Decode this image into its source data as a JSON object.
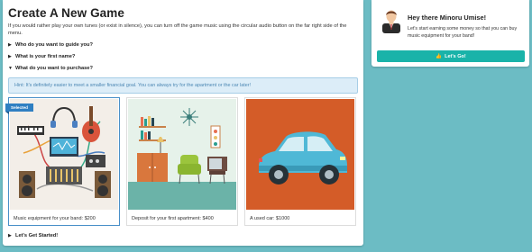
{
  "main": {
    "title": "Create A New Game",
    "intro": "If you would rather play your own tunes (or exist in silence), you can turn off the game music using the circular audio button on the far right side of the menu.",
    "accordion": [
      {
        "label": "Who do you want to guide you?"
      },
      {
        "label": "What is your first name?"
      },
      {
        "label": "What do you want to purchase?"
      }
    ],
    "hint": "Hint: It's definitely easier to meet a smaller financial goal. You can always try for the apartment or the car later!",
    "options": [
      {
        "caption": "Music equipment for your band: $200",
        "badge": "Selected"
      },
      {
        "caption": "Deposit for your first apartment: $400"
      },
      {
        "caption": "A used car: $1000"
      }
    ],
    "start_label": "Let's Get Started!"
  },
  "side": {
    "greeting": "Hey there Minoru Umise!",
    "text": "Let's start earning some money so that you can buy music equipment for your band!",
    "button_label": "Let's Go!"
  },
  "colors": {
    "background": "#6cbcc4",
    "accent": "#19b3a9",
    "selected": "#2f7fc2",
    "hint_bg": "#dcedf8"
  }
}
